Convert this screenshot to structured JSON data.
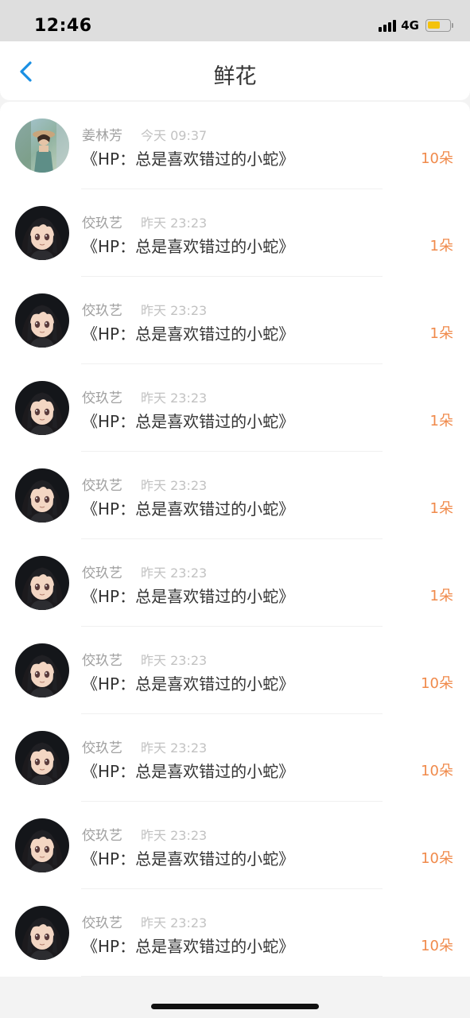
{
  "status_bar": {
    "time": "12:46",
    "network": "4G",
    "battery_color": "#f4c20d"
  },
  "nav": {
    "title": "鲜花",
    "back_icon": "chevron-left-icon",
    "accent_color": "#1a8fe3"
  },
  "items": [
    {
      "user": "姜林芳",
      "time": "今天 09:37",
      "book": "《HP：总是喜欢错过的小蛇》",
      "count": "10朵",
      "avatar": "photo-avatar"
    },
    {
      "user": "佼玖艺",
      "time": "昨天 23:23",
      "book": "《HP：总是喜欢错过的小蛇》",
      "count": "1朵",
      "avatar": "anime-girl-avatar"
    },
    {
      "user": "佼玖艺",
      "time": "昨天 23:23",
      "book": "《HP：总是喜欢错过的小蛇》",
      "count": "1朵",
      "avatar": "anime-girl-avatar"
    },
    {
      "user": "佼玖艺",
      "time": "昨天 23:23",
      "book": "《HP：总是喜欢错过的小蛇》",
      "count": "1朵",
      "avatar": "anime-girl-avatar"
    },
    {
      "user": "佼玖艺",
      "time": "昨天 23:23",
      "book": "《HP：总是喜欢错过的小蛇》",
      "count": "1朵",
      "avatar": "anime-girl-avatar"
    },
    {
      "user": "佼玖艺",
      "time": "昨天 23:23",
      "book": "《HP：总是喜欢错过的小蛇》",
      "count": "1朵",
      "avatar": "anime-girl-avatar"
    },
    {
      "user": "佼玖艺",
      "time": "昨天 23:23",
      "book": "《HP：总是喜欢错过的小蛇》",
      "count": "10朵",
      "avatar": "anime-girl-avatar"
    },
    {
      "user": "佼玖艺",
      "time": "昨天 23:23",
      "book": "《HP：总是喜欢错过的小蛇》",
      "count": "10朵",
      "avatar": "anime-girl-avatar"
    },
    {
      "user": "佼玖艺",
      "time": "昨天 23:23",
      "book": "《HP：总是喜欢错过的小蛇》",
      "count": "10朵",
      "avatar": "anime-girl-avatar"
    },
    {
      "user": "佼玖艺",
      "time": "昨天 23:23",
      "book": "《HP：总是喜欢错过的小蛇》",
      "count": "10朵",
      "avatar": "anime-girl-avatar"
    }
  ]
}
